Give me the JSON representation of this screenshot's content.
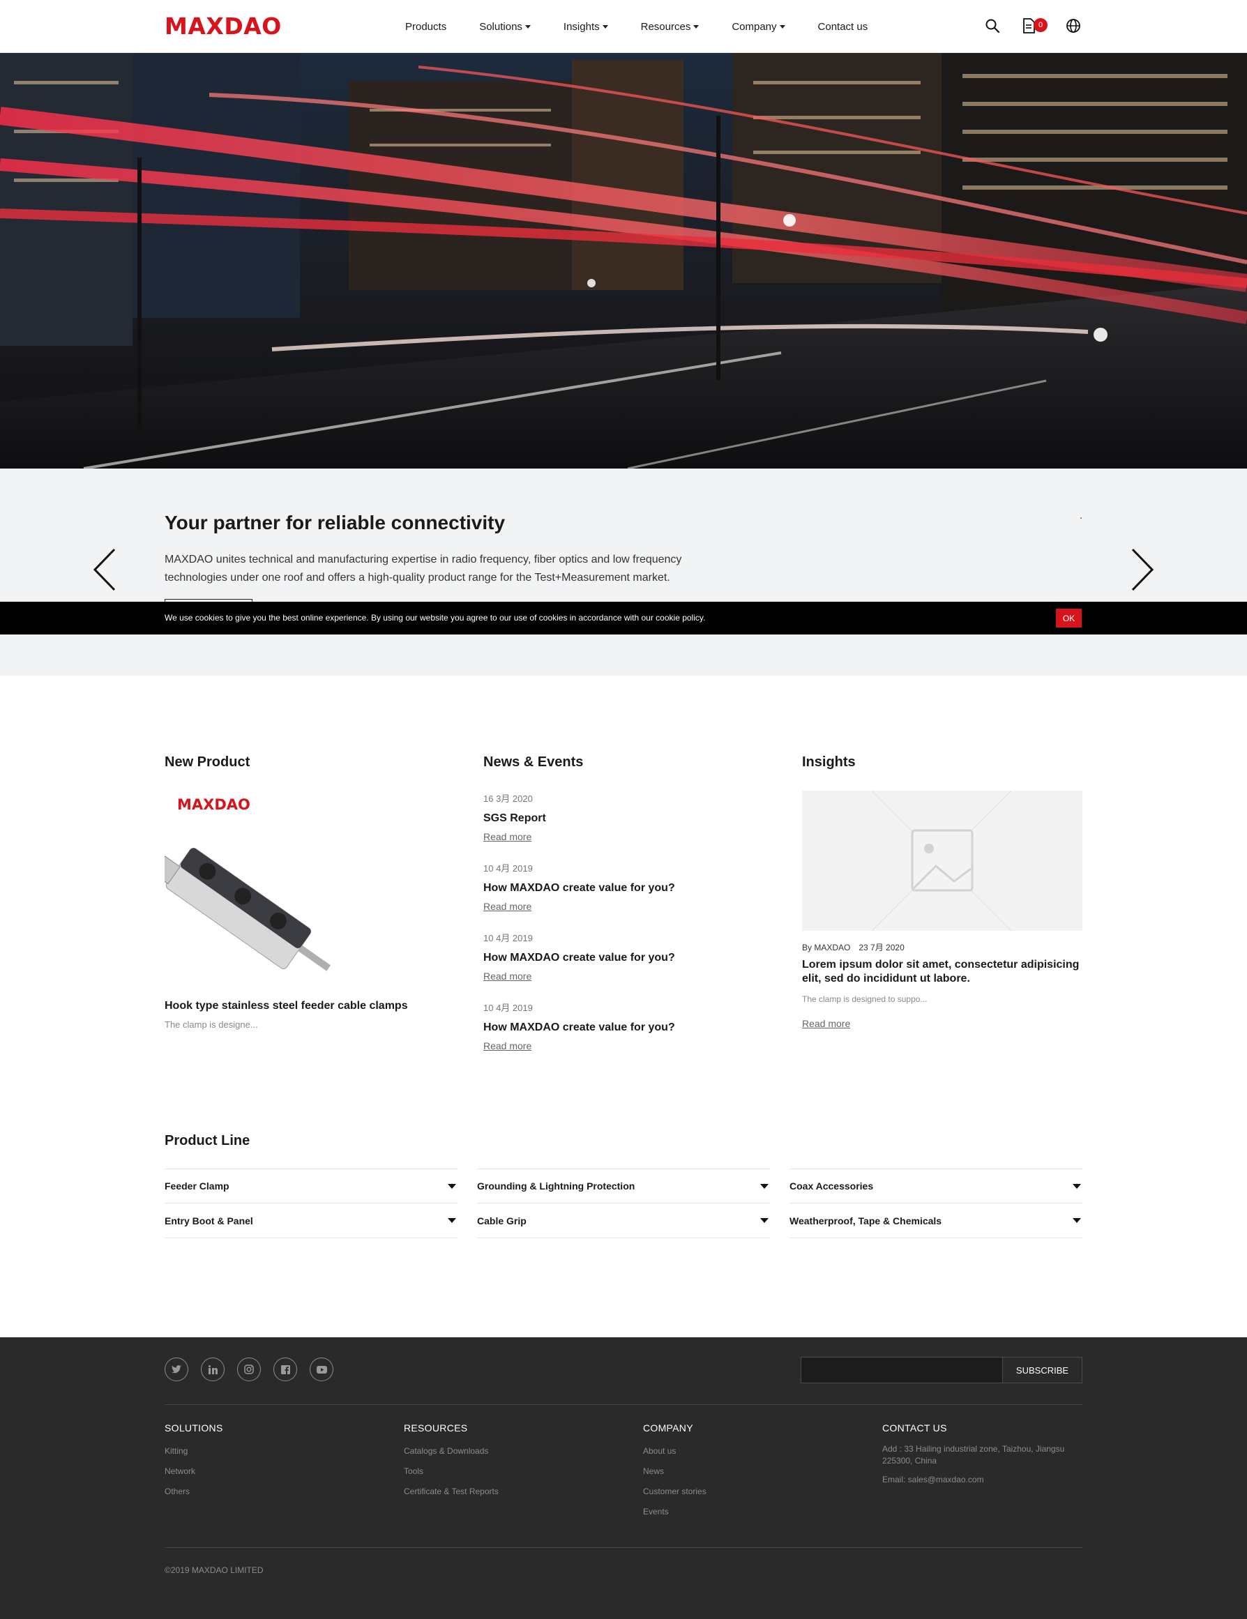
{
  "header": {
    "logo": "MAXDAO",
    "nav": [
      {
        "label": "Products",
        "dropdown": false
      },
      {
        "label": "Solutions",
        "dropdown": true
      },
      {
        "label": "Insights",
        "dropdown": true
      },
      {
        "label": "Resources",
        "dropdown": true
      },
      {
        "label": "Company",
        "dropdown": true
      },
      {
        "label": "Contact us",
        "dropdown": false
      }
    ],
    "icons": [
      "search-icon",
      "quote-cart-icon",
      "globe-icon"
    ],
    "cart_count": "0"
  },
  "slider": {
    "title": "Your partner for reliable connectivity",
    "text": "MAXDAO unites technical and manufacturing expertise in radio frequency, fiber optics and low frequency technologies under one roof and offers a high-quality product range for the Test+Measurement market."
  },
  "cookie": {
    "text": "We use cookies to give you the best online experience. By using our website you agree to our use of cookies in accordance with our cookie policy.",
    "ok": "OK"
  },
  "new_product": {
    "heading": "New Product",
    "image_logo": "MAXDAO",
    "name": "Hook type stainless steel feeder cable clamps",
    "desc": "The clamp is designe..."
  },
  "news": {
    "heading": "News & Events",
    "items": [
      {
        "date": "16 3月 2020",
        "title": "SGS Report",
        "more": "Read more"
      },
      {
        "date": "10 4月 2019",
        "title": "How MAXDAO create value for you?",
        "more": "Read more"
      },
      {
        "date": "10 4月 2019",
        "title": "How MAXDAO create value for you?",
        "more": "Read more"
      },
      {
        "date": "10 4月 2019",
        "title": "How MAXDAO create value for you?",
        "more": "Read more"
      }
    ]
  },
  "insights": {
    "heading": "Insights",
    "author": "By MAXDAO",
    "date": "23 7月 2020",
    "title": "Lorem ipsum dolor sit amet, consectetur adipisicing elit, sed do incididunt ut labore.",
    "desc": "The clamp is designed to suppo...",
    "more": "Read more"
  },
  "product_line": {
    "heading": "Product Line",
    "items": [
      "Feeder Clamp",
      "Grounding & Lightning Protection",
      "Coax Accessories",
      "Entry Boot & Panel",
      "Cable Grip",
      "Weatherproof, Tape & Chemicals"
    ]
  },
  "footer": {
    "social": [
      "twitter-icon",
      "linkedin-icon",
      "instagram-icon",
      "facebook-icon",
      "youtube-icon"
    ],
    "subscribe_label": "SUBSCRIBE",
    "subscribe_placeholder": "",
    "columns": [
      {
        "heading": "SOLUTIONS",
        "links": [
          "Kitting",
          "Network",
          "Others"
        ]
      },
      {
        "heading": "RESOURCES",
        "links": [
          "Catalogs & Downloads",
          "Tools",
          "Certificate & Test Reports"
        ]
      },
      {
        "heading": "COMPANY",
        "links": [
          "About us",
          "News",
          "Customer stories",
          "Events"
        ]
      }
    ],
    "contact": {
      "heading": "CONTACT US",
      "address": "Add : 33 Hailing industrial zone, Taizhou, Jiangsu 225300, China",
      "email": "Email: sales@maxdao.com"
    },
    "copyright": "©2019 MAXDAO LIMITED"
  },
  "colors": {
    "brand_red": "#d7141c",
    "footer_bg": "#2a2a2a",
    "caption_bg": "#f2f3f4"
  }
}
